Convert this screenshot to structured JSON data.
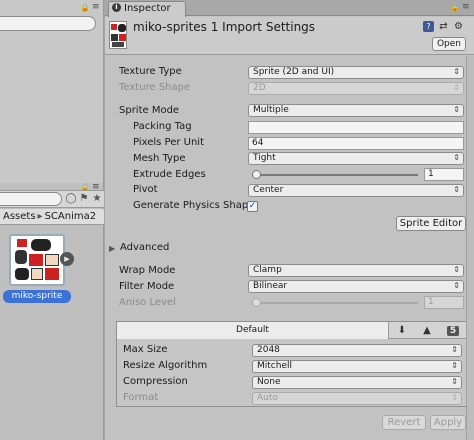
{
  "left_pane": {
    "breadcrumb": [
      "Assets",
      "SCAnima2"
    ],
    "asset": {
      "label": "miko-sprite"
    },
    "icons": [
      "lock-icon",
      "menu-icon",
      "search-icon",
      "tag-icon",
      "star-icon",
      "play-icon"
    ]
  },
  "inspector": {
    "tab_label": "Inspector",
    "title": "miko-sprites 1 Import Settings",
    "open_button": "Open",
    "header_icons": [
      "help-icon",
      "preset-icon",
      "settings-gear-icon"
    ],
    "texture_type": {
      "label": "Texture Type",
      "value": "Sprite (2D and UI)"
    },
    "texture_shape": {
      "label": "Texture Shape",
      "value": "2D",
      "disabled": true
    },
    "sprite_mode": {
      "label": "Sprite Mode",
      "value": "Multiple"
    },
    "packing_tag": {
      "label": "Packing Tag",
      "value": ""
    },
    "pixels_per_unit": {
      "label": "Pixels Per Unit",
      "value": "64"
    },
    "mesh_type": {
      "label": "Mesh Type",
      "value": "Tight"
    },
    "extrude_edges": {
      "label": "Extrude Edges",
      "value": "1",
      "fraction": 0.0
    },
    "pivot": {
      "label": "Pivot",
      "value": "Center"
    },
    "generate_physics": {
      "label": "Generate Physics Shap",
      "checked": true
    },
    "sprite_editor_button": "Sprite Editor",
    "advanced": {
      "label": "Advanced",
      "expanded": false
    },
    "wrap_mode": {
      "label": "Wrap Mode",
      "value": "Clamp"
    },
    "filter_mode": {
      "label": "Filter Mode",
      "value": "Bilinear"
    },
    "aniso_level": {
      "label": "Aniso Level",
      "value": "1",
      "fraction": 0.0,
      "disabled": true
    },
    "platform": {
      "default_tab": "Default",
      "platform_icons": [
        "download-icon",
        "android-icon",
        "html5-icon"
      ],
      "html5_glyph": "5",
      "max_size": {
        "label": "Max Size",
        "value": "2048"
      },
      "resize_algorithm": {
        "label": "Resize Algorithm",
        "value": "Mitchell"
      },
      "compression": {
        "label": "Compression",
        "value": "None"
      },
      "format": {
        "label": "Format",
        "value": "Auto",
        "disabled": true
      }
    },
    "revert_button": "Revert",
    "apply_button": "Apply"
  }
}
